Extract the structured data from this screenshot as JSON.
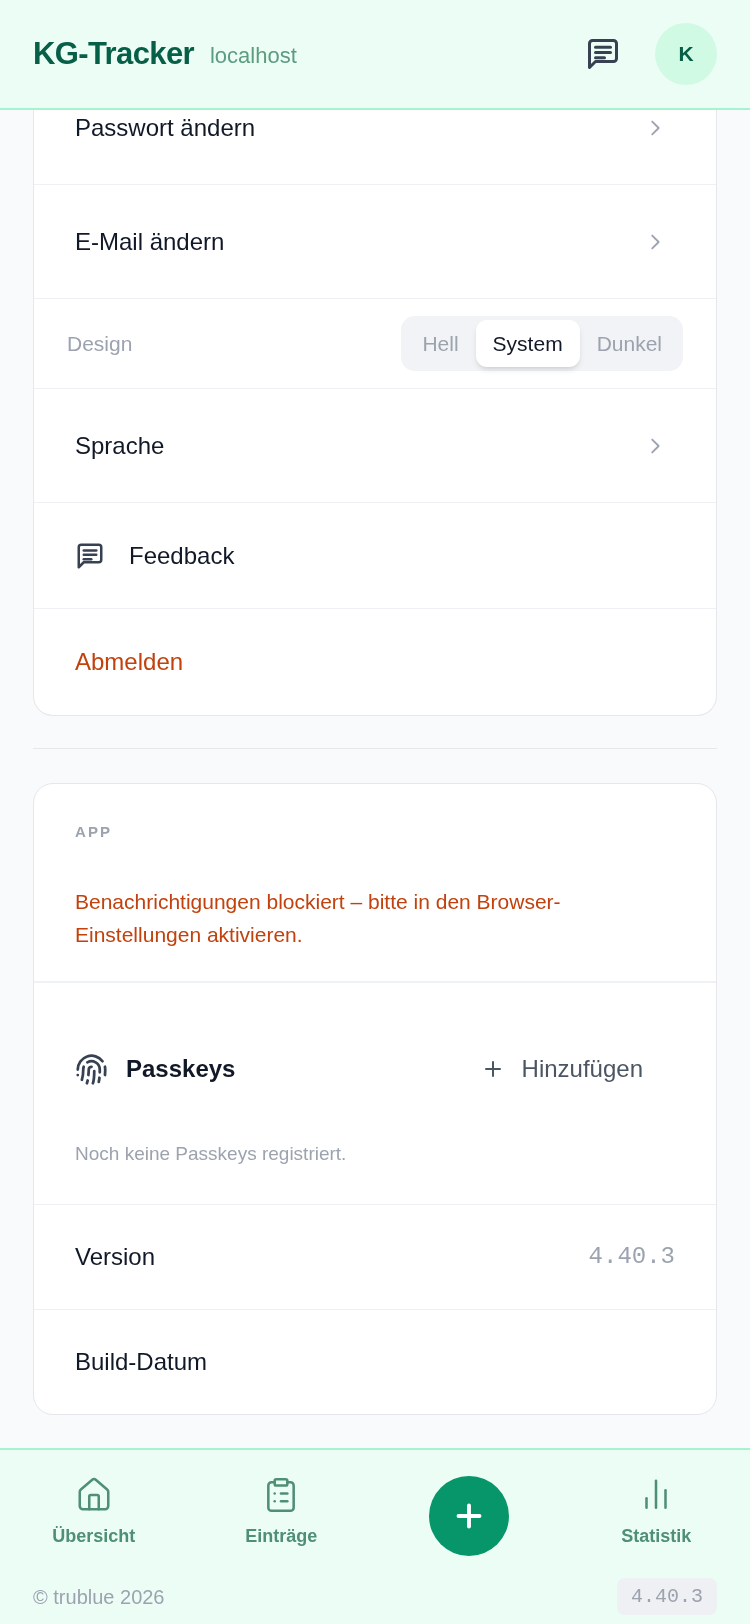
{
  "header": {
    "title": "KG-Tracker",
    "subtitle": "localhost",
    "avatar": "K"
  },
  "account_settings": {
    "items": [
      {
        "kind": "link",
        "label": "Passwort ändern"
      },
      {
        "kind": "link",
        "label": "E-Mail ändern"
      },
      {
        "kind": "segmented",
        "label": "Design",
        "options": [
          {
            "label": "Hell",
            "selected": false
          },
          {
            "label": "System",
            "selected": true
          },
          {
            "label": "Dunkel",
            "selected": false
          }
        ]
      },
      {
        "kind": "link",
        "label": "Sprache"
      },
      {
        "kind": "icon_action",
        "label": "Feedback"
      },
      {
        "kind": "danger",
        "label": "Abmelden"
      }
    ]
  },
  "app_card": {
    "heading": "APP",
    "notice": "Benachrichtigungen blockiert – bitte in den Browser-Einstellungen aktivieren.",
    "passkeys": {
      "title": "Passkeys",
      "add_button": "Hinzufügen",
      "empty_text": "Noch keine Passkeys registriert."
    },
    "info_rows": [
      {
        "label": "Version",
        "value": "4.40.3"
      },
      {
        "label": "Build-Datum"
      }
    ]
  },
  "bottom_nav": {
    "items": [
      {
        "kind": "tab",
        "label": "Übersicht",
        "selected": false
      },
      {
        "kind": "tab",
        "label": "Einträge",
        "selected": false
      },
      {
        "kind": "action"
      },
      {
        "kind": "tab",
        "label": "Statistik",
        "selected": false
      }
    ]
  },
  "footer": {
    "copyright": "© trublue 2026",
    "version": "4.40.3"
  }
}
